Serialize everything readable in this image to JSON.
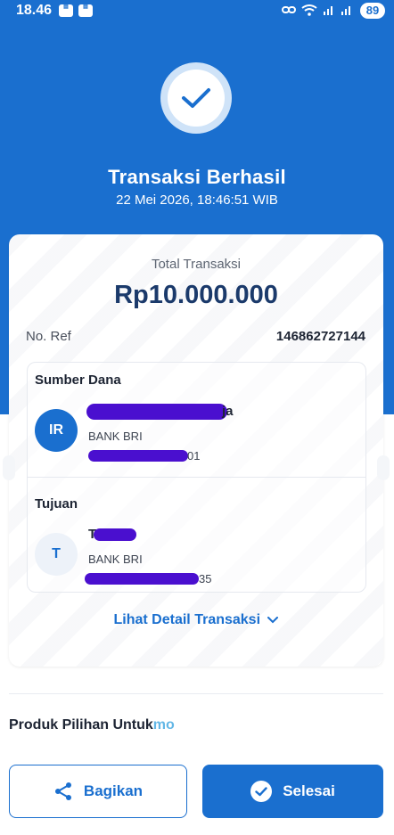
{
  "status_bar": {
    "time": "18.46",
    "battery": "89",
    "icon_names": [
      "notification-box-icon",
      "notification-box-icon",
      "link-icon",
      "wifi-icon",
      "signal-icon",
      "signal-icon"
    ]
  },
  "header": {
    "title": "Transaksi Berhasil",
    "datetime": "22 Mei 2026, 18:46:51 WIB",
    "background": "#1a6fcf"
  },
  "summary": {
    "total_label": "Total Transaksi",
    "total_amount": "Rp10.000.000",
    "ref_label": "No. Ref",
    "ref_value": "146862727144"
  },
  "source": {
    "section_label": "Sumber Dana",
    "initials": "IR",
    "name_visible_tail": "ja",
    "bank": "BANK BRI",
    "account_visible_tail": "01"
  },
  "destination": {
    "section_label": "Tujuan",
    "initials": "T",
    "name_visible_head": "T",
    "bank": "BANK BRI",
    "account_visible_tail": "35"
  },
  "detail_link": "Lihat Detail Transaksi",
  "produk": {
    "label": "Produk Pilihan Untuk",
    "logo_text": "mo"
  },
  "buttons": {
    "share_label": "Bagikan",
    "done_label": "Selesai"
  },
  "colors": {
    "accent": "#1a6fcf",
    "amount": "#1b3a6b",
    "redaction": "#4a0fcf"
  }
}
